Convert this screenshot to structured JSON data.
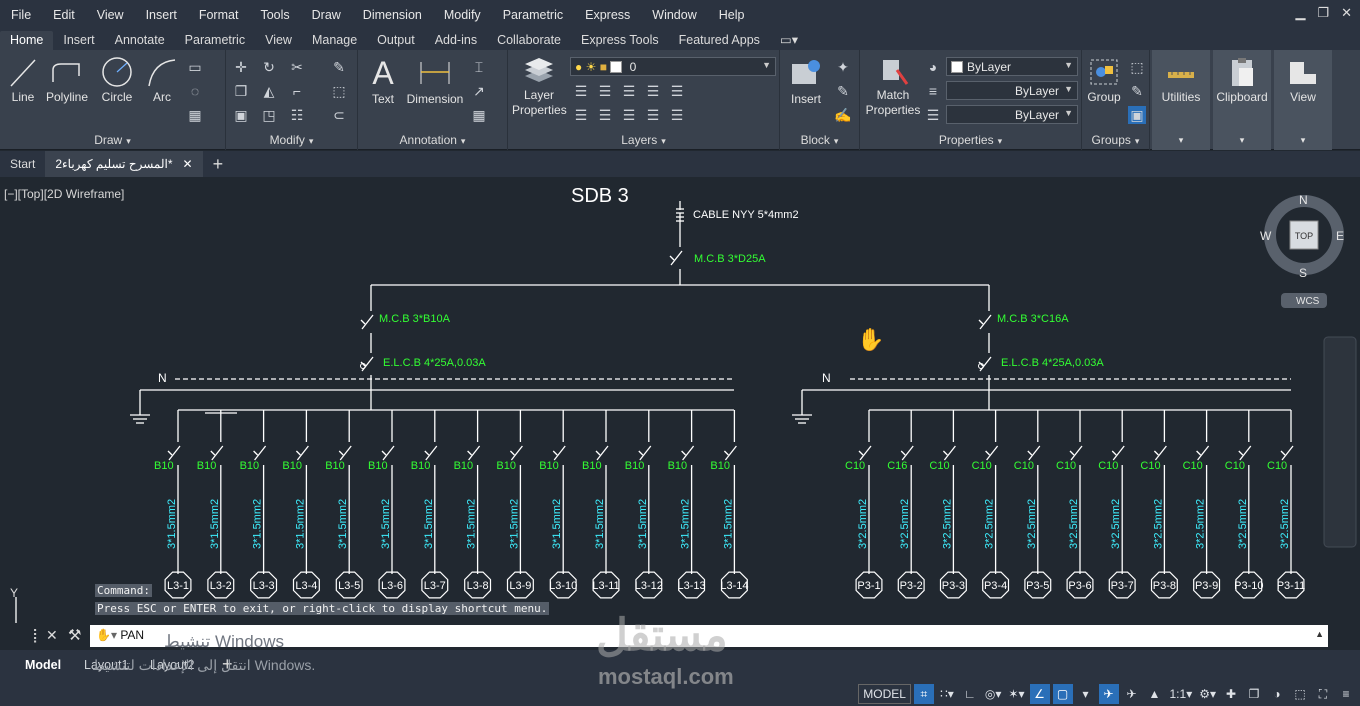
{
  "menu": [
    "File",
    "Edit",
    "View",
    "Insert",
    "Format",
    "Tools",
    "Draw",
    "Dimension",
    "Modify",
    "Parametric",
    "Express",
    "Window",
    "Help"
  ],
  "ribbon_tabs": [
    "Home",
    "Insert",
    "Annotate",
    "Parametric",
    "View",
    "Manage",
    "Output",
    "Add-ins",
    "Collaborate",
    "Express Tools",
    "Featured Apps"
  ],
  "active_ribbon_tab": "Home",
  "draw": {
    "line": "Line",
    "polyline": "Polyline",
    "circle": "Circle",
    "arc": "Arc",
    "panel": "Draw"
  },
  "modify": {
    "panel": "Modify"
  },
  "annotation": {
    "text": "Text",
    "dimension": "Dimension",
    "panel": "Annotation"
  },
  "layers": {
    "props": "Layer Properties",
    "current_layer": "0",
    "panel": "Layers"
  },
  "block": {
    "insert": "Insert",
    "panel": "Block"
  },
  "properties": {
    "match": "Match Properties",
    "color": "ByLayer",
    "linetype": "ByLayer",
    "lineweight": "ByLayer",
    "panel": "Properties"
  },
  "groups": {
    "group": "Group",
    "panel": "Groups"
  },
  "utilities": "Utilities",
  "clipboard": "Clipboard",
  "view_btn": "View",
  "file_tabs": {
    "start": "Start",
    "doc": "المسرح تسليم كهرباء2*"
  },
  "viewport_label": "[−][Top][2D Wireframe]",
  "viewcube": {
    "n": "N",
    "s": "S",
    "e": "E",
    "w": "W",
    "top": "TOP",
    "wcs": "WCS"
  },
  "drawing": {
    "title": "SDB 3",
    "cable": "CABLE NYY 5*4mm2",
    "main_mcb": "M.C.B 3*D25A",
    "left": {
      "mcb": "M.C.B 3*B10A",
      "elcb": "E.L.C.B 4*25A,0.03A",
      "neutral": "N",
      "breaker": "B10",
      "cable": "3*1.5mm2",
      "circuits": [
        "L3-1",
        "L3-2",
        "L3-3",
        "L3-4",
        "L3-5",
        "L3-6",
        "L3-7",
        "L3-8",
        "L3-9",
        "L3-10",
        "L3-11",
        "L3-12",
        "L3-13",
        "L3-14"
      ]
    },
    "right": {
      "mcb": "M.C.B 3*C16A",
      "elcb": "E.L.C.B 4*25A,0.03A",
      "neutral": "N",
      "breakers": [
        "C10",
        "C16",
        "C10",
        "C10",
        "C10",
        "C10",
        "C10",
        "C10",
        "C10",
        "C10",
        "C10"
      ],
      "cable": "3*2.5mm2",
      "circuits": [
        "P3-1",
        "P3-2",
        "P3-3",
        "P3-4",
        "P3-5",
        "P3-6",
        "P3-7",
        "P3-8",
        "P3-9",
        "P3-10",
        "P3-11"
      ]
    }
  },
  "command": {
    "history_label": "Command:",
    "history_msg": "Press ESC or ENTER to exit, or right-click to display shortcut menu.",
    "input": "PAN"
  },
  "layout_tabs": [
    "Model",
    "Layout1",
    "Layout2"
  ],
  "status": {
    "model": "MODEL",
    "scale": "1:1"
  },
  "watermark": {
    "line1": "تنشيط Windows",
    "line2": "انتقل إلى الإعدادات لتنشيط Windows.",
    "brand_ar": "مستقل",
    "brand": "mostaql.com"
  },
  "colors": {
    "wire": "#ffffff",
    "green_text": "#33ff33",
    "cyan_text": "#3ef0ff",
    "bg": "#212830"
  }
}
